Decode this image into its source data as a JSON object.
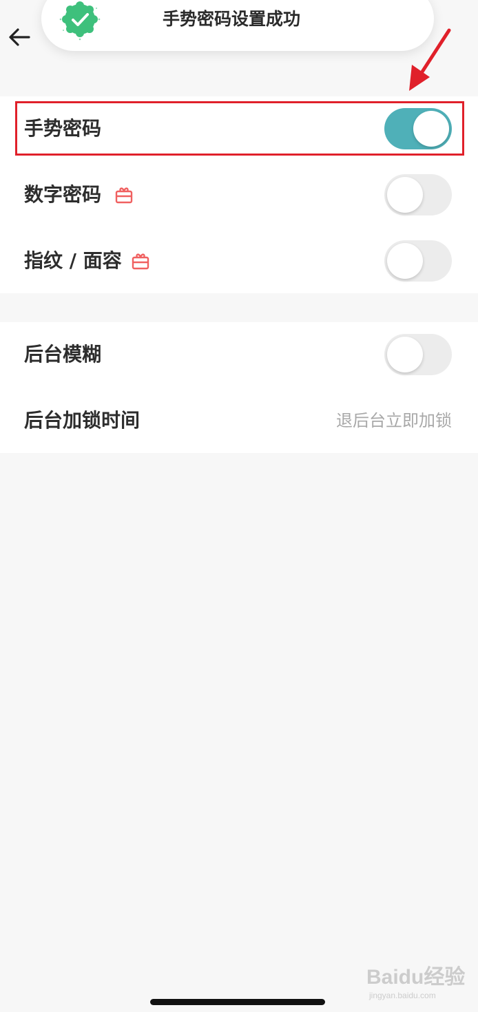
{
  "toast": {
    "message": "手势密码设置成功",
    "icon": "check-badge-icon",
    "icon_color": "#3ec07c"
  },
  "nav": {
    "back_icon": "arrow-left-icon"
  },
  "security_section": {
    "items": [
      {
        "label": "手势密码",
        "toggle_on": true
      },
      {
        "label": "数字密码",
        "toggle_on": false,
        "badge_icon": "gift-icon"
      },
      {
        "label": "指纹 / 面容",
        "toggle_on": false,
        "badge_icon": "gift-icon"
      }
    ]
  },
  "background_section": {
    "blur": {
      "label": "后台模糊",
      "toggle_on": false
    },
    "lock_time": {
      "label": "后台加锁时间",
      "value": "退后台立即加锁"
    }
  },
  "colors": {
    "toggle_on": "#4fb0b8",
    "toggle_off": "#ececec",
    "badge": "#f06060",
    "highlight": "#e0202a"
  },
  "watermark": {
    "main": "Baidu经验",
    "sub": "jingyan.baidu.com"
  }
}
